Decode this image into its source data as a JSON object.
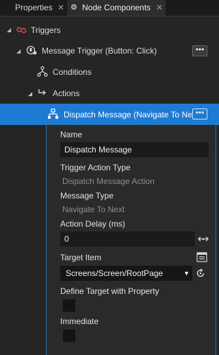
{
  "tabs": [
    {
      "label": "Properties",
      "active": false
    },
    {
      "label": "Node Components",
      "active": true
    }
  ],
  "tree": {
    "triggers": "Triggers",
    "message_trigger": "Message Trigger (Button: Click)",
    "conditions": "Conditions",
    "actions": "Actions",
    "dispatch": "Dispatch Message (Navigate To Nex"
  },
  "more_label": "•••",
  "props": {
    "name_label": "Name",
    "name_value": "Dispatch Message",
    "trigger_action_type_label": "Trigger Action Type",
    "trigger_action_type_value": "Dispatch Message Action",
    "message_type_label": "Message Type",
    "message_type_value": "Navigate To Next",
    "action_delay_label": "Action Delay (ms)",
    "action_delay_value": "0",
    "target_item_label": "Target Item",
    "target_item_value": "Screens/Screen/RootPage",
    "define_target_label": "Define Target with Property",
    "define_target_checked": false,
    "immediate_label": "Immediate",
    "immediate_checked": false
  },
  "colors": {
    "selection": "#1e7bd4",
    "trigger_icon": "#e04a4a"
  }
}
